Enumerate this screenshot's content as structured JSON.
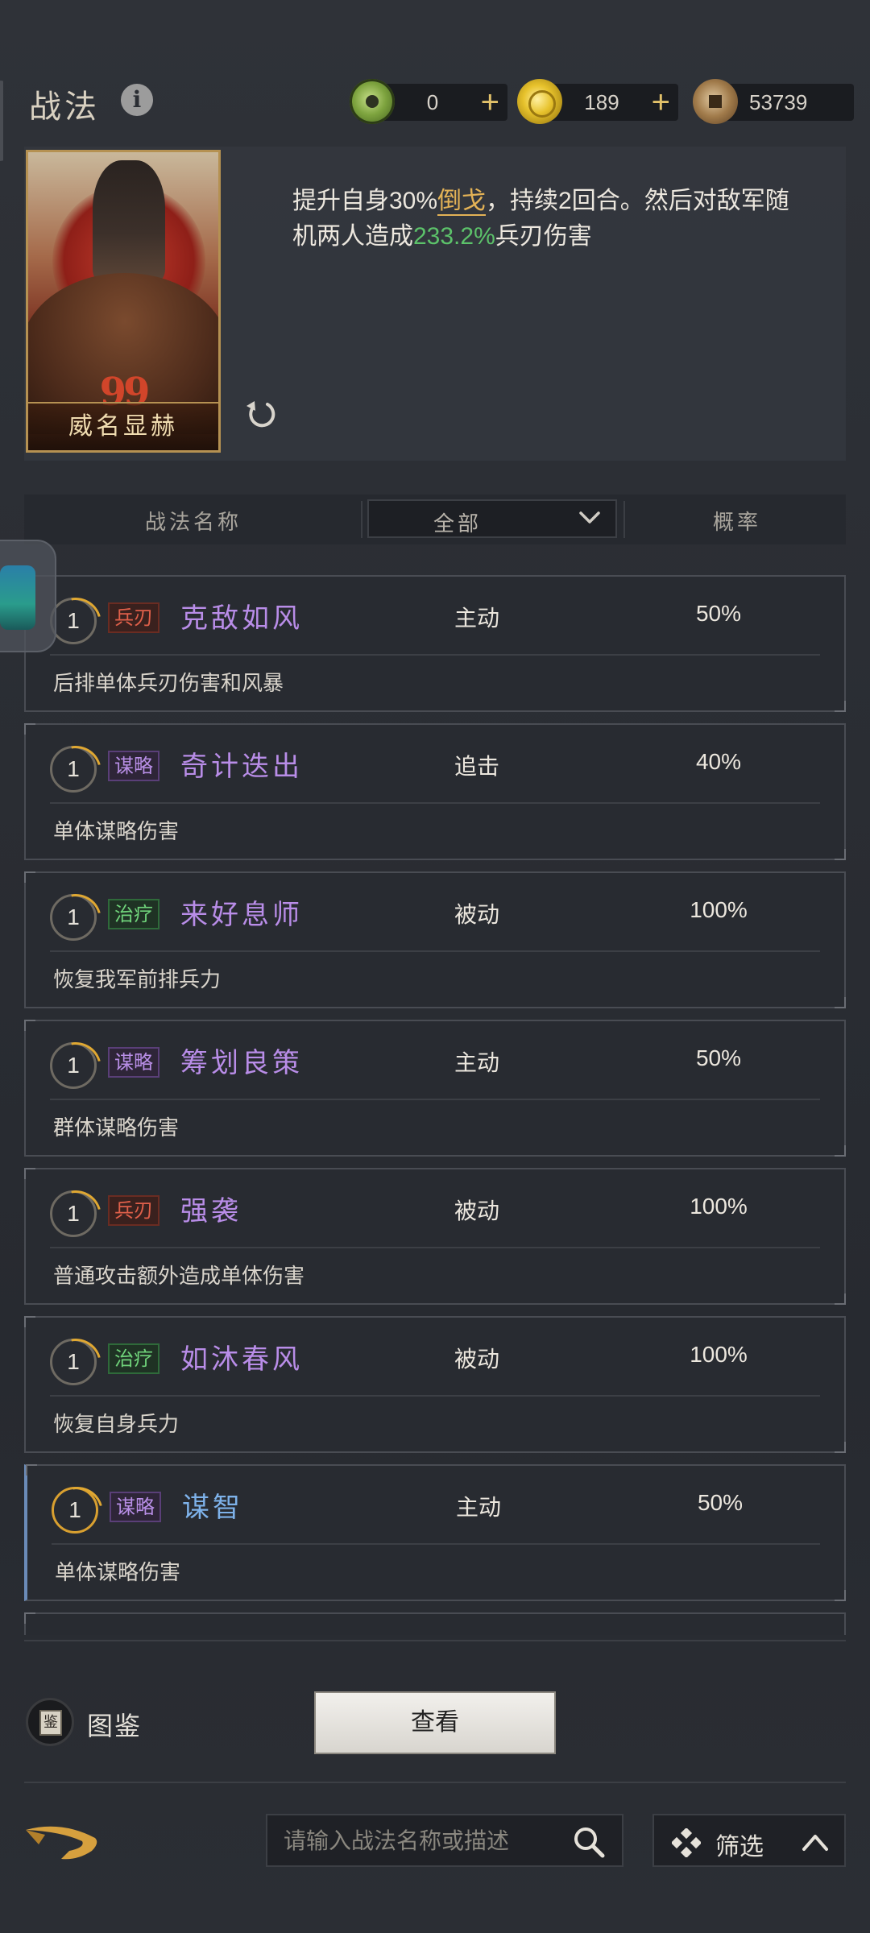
{
  "header": {
    "title": "战法",
    "info_icon": "i",
    "currencies": [
      {
        "icon": "jade-coin-icon",
        "value": "0",
        "plus": "+"
      },
      {
        "icon": "gold-coin-icon",
        "value": "189",
        "plus": "+"
      },
      {
        "icon": "copper-coin-icon",
        "value": "53739"
      }
    ]
  },
  "detail": {
    "card_name": "威名显赫",
    "card_quote": "99",
    "desc_parts": {
      "a": "提升自身30%",
      "b": "倒戈",
      "c": "，持续2回合。然后对敌军随机两人造成",
      "d": "233.2%",
      "e": "兵刃伤害"
    }
  },
  "list_header": {
    "name_col": "战法名称",
    "filter_value": "全部",
    "rate_col": "概率"
  },
  "skills": [
    {
      "level": "1",
      "tag": "兵刃",
      "name": "克敌如风",
      "type": "主动",
      "rate": "50%",
      "desc": "后排单体兵刃伤害和风暴"
    },
    {
      "level": "1",
      "tag": "谋略",
      "name": "奇计迭出",
      "type": "追击",
      "rate": "40%",
      "desc": "单体谋略伤害"
    },
    {
      "level": "1",
      "tag": "治疗",
      "name": "来好息师",
      "type": "被动",
      "rate": "100%",
      "desc": "恢复我军前排兵力"
    },
    {
      "level": "1",
      "tag": "谋略",
      "name": "筹划良策",
      "type": "主动",
      "rate": "50%",
      "desc": "群体谋略伤害"
    },
    {
      "level": "1",
      "tag": "兵刃",
      "name": "强袭",
      "type": "被动",
      "rate": "100%",
      "desc": "普通攻击额外造成单体伤害"
    },
    {
      "level": "1",
      "tag": "治疗",
      "name": "如沐春风",
      "type": "被动",
      "rate": "100%",
      "desc": "恢复自身兵力"
    },
    {
      "level": "1",
      "tag": "谋略",
      "name": "谋智",
      "type": "主动",
      "rate": "50%",
      "desc": "单体谋略伤害"
    }
  ],
  "bottom": {
    "codex_icon_text": "鉴",
    "codex_label": "图鉴",
    "view_button": "查看",
    "search_placeholder": "请输入战法名称或描述",
    "filter_label": "筛选"
  },
  "colors": {
    "accent_gold": "#e3b256",
    "highlight_green": "#5cc26a",
    "tag_blade": "#e0604a",
    "tag_plan": "#b88ee6",
    "tag_heal": "#6fd27a"
  }
}
